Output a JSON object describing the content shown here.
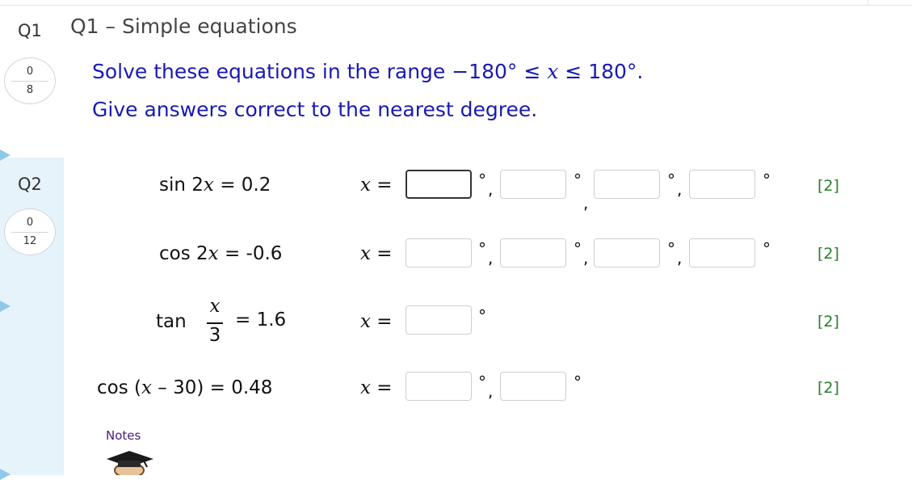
{
  "questions": [
    {
      "label": "Q1",
      "score_top": "0",
      "score_bottom": "8"
    },
    {
      "label": "Q2",
      "score_top": "0",
      "score_bottom": "12"
    }
  ],
  "q1": {
    "title": "Q1 – Simple equations",
    "instruction_prefix": "Solve these equations in the range −180° ≤ ",
    "instruction_var": "x",
    "instruction_suffix": " ≤ 180°.",
    "instruction_line2": "Give answers correct to the nearest degree."
  },
  "equations": [
    {
      "func": "sin 2",
      "var": "x",
      "rhs": " = 0.2",
      "answers": [
        "",
        "",
        "",
        ""
      ],
      "marks": "[2]"
    },
    {
      "func": "cos 2",
      "var": "x",
      "rhs": " = -0.6",
      "answers": [
        "",
        "",
        "",
        ""
      ],
      "marks": "[2]"
    },
    {
      "func": "tan",
      "frac_num": "x",
      "frac_den": "3",
      "rhs": "= 1.6",
      "answers": [
        ""
      ],
      "marks": "[2]"
    },
    {
      "func_pre": "cos (",
      "var": "x",
      "func_post": " – 30) = 0.48",
      "answers": [
        "",
        ""
      ],
      "marks": "[2]"
    }
  ],
  "x_label": "x",
  "x_equals": " =",
  "degree_symbol": "°",
  "comma": ",",
  "notes_label": "Notes",
  "colors": {
    "instruction": "#1a1ab0",
    "marks": "#2a7d2a",
    "sidebar": "#e6f3fa",
    "arrow": "#8ec9ea"
  }
}
